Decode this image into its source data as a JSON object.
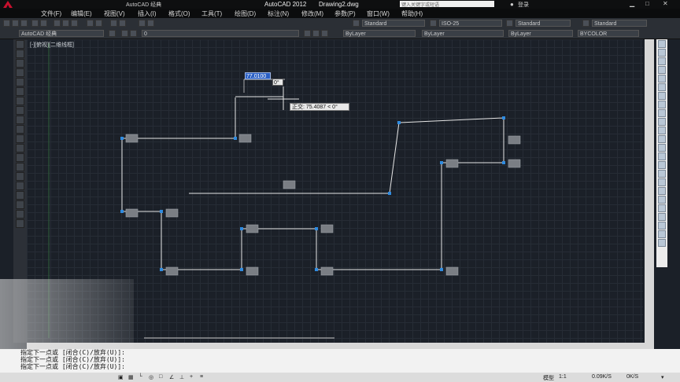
{
  "app": {
    "title": "AutoCAD 2012",
    "document": "Drawing2.dwg",
    "search_placeholder": "键入关键字或短语",
    "login_label": "登录",
    "quick_workspace": "AutoCAD 经典"
  },
  "menu": [
    "文件(F)",
    "编辑(E)",
    "视图(V)",
    "插入(I)",
    "格式(O)",
    "工具(T)",
    "绘图(D)",
    "标注(N)",
    "修改(M)",
    "参数(P)",
    "窗口(W)",
    "帮助(H)"
  ],
  "toolbar1": {
    "text_style": "Standard",
    "dim_style": "ISO-25",
    "table_style": "Standard",
    "mleader_style": "Standard"
  },
  "toolbar2": {
    "workspace": "AutoCAD 经典",
    "layer": "0",
    "color": "ByLayer",
    "linetype": "ByLayer",
    "lineweight": "ByLayer",
    "plotstyle": "BYCOLOR"
  },
  "viewport": {
    "label": "[-][俯视][二维线框]"
  },
  "input": {
    "dimension_value": "77.0100",
    "angle_value": "0°",
    "polar_tooltip": "正交: 75.4087 < 0°"
  },
  "command": {
    "lines": [
      "指定下一点或 [闭合(C)/放弃(U)]:",
      "指定下一点或 [闭合(C)/放弃(U)]:",
      "指定下一点或 [闭合(C)/放弃(U)]:"
    ]
  },
  "status": {
    "model": "模型",
    "scale": "1:1",
    "speed1": "0.09K/S",
    "speed2": "0K/S"
  },
  "colors": {
    "background": "#1b2028",
    "grid": "#262c35",
    "line": "#e6e6e6",
    "grip": "#2f8be0",
    "dim_highlight": "#2a5fc4"
  }
}
